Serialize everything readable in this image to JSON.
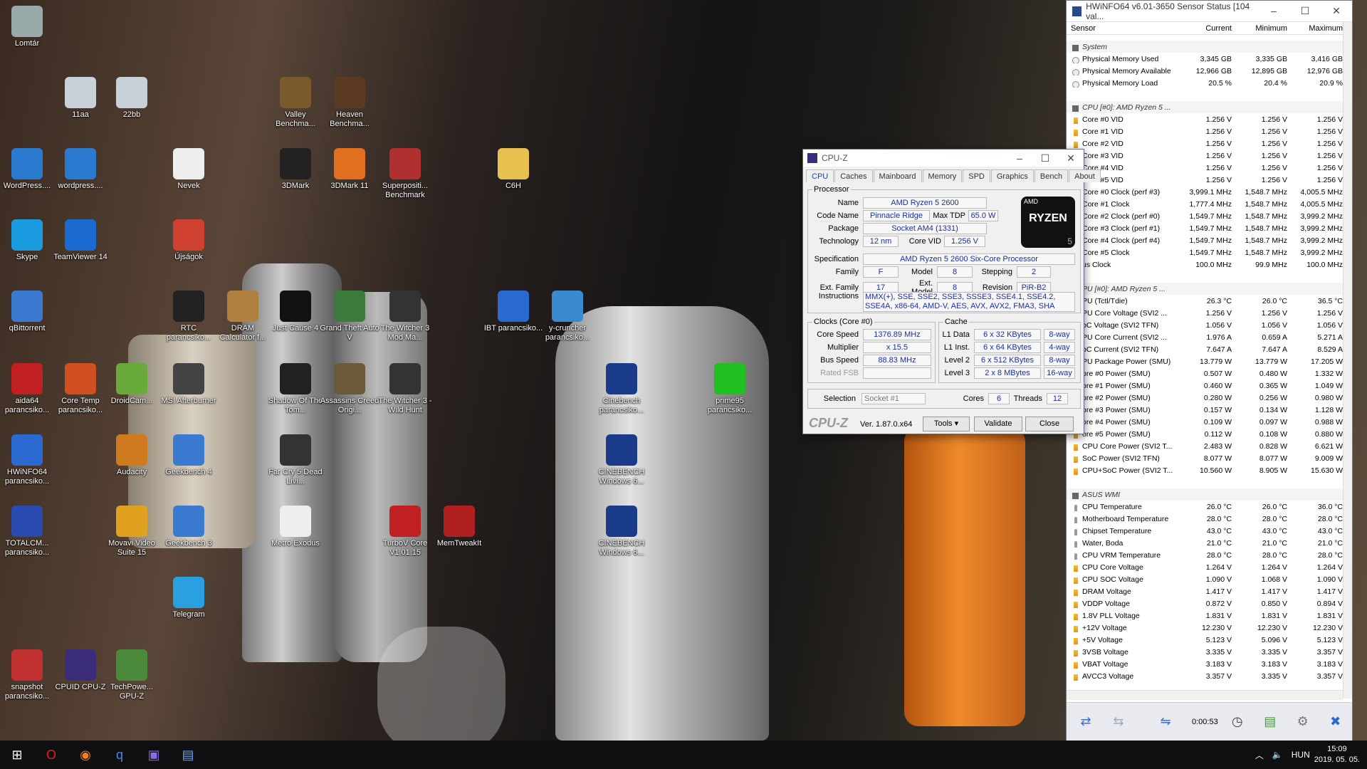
{
  "desktop": {
    "icons": [
      {
        "label": "Lomtár",
        "icon": "recycle-bin-icon",
        "color": "#9aa"
      },
      {
        "label": "11aa",
        "icon": "image-file-icon",
        "color": "#c8d0d8"
      },
      {
        "label": "22bb",
        "icon": "image-file-icon",
        "color": "#c8d0d8"
      },
      {
        "label": "Valley Benchma...",
        "icon": "valley-benchmark-icon",
        "color": "#7a5a2a"
      },
      {
        "label": "Heaven Benchma...",
        "icon": "heaven-benchmark-icon",
        "color": "#5a3a22"
      },
      {
        "label": "WordPress....",
        "icon": "wordpress-icon",
        "color": "#2a7ad0"
      },
      {
        "label": "wordpress....",
        "icon": "wordpress-icon",
        "color": "#2a7ad0"
      },
      {
        "label": "Nevek",
        "icon": "text-file-icon",
        "color": "#eee"
      },
      {
        "label": "3DMark",
        "icon": "3dmark-icon",
        "color": "#222"
      },
      {
        "label": "3DMark 11",
        "icon": "3dmark11-icon",
        "color": "#e07020"
      },
      {
        "label": "Superpositi... Benchmark",
        "icon": "superposition-icon",
        "color": "#b03030"
      },
      {
        "label": "C6H",
        "icon": "folder-icon",
        "color": "#e8c050"
      },
      {
        "label": "Skype",
        "icon": "skype-icon",
        "color": "#1a9be0"
      },
      {
        "label": "TeamViewer 14",
        "icon": "teamviewer-icon",
        "color": "#1a6ad0"
      },
      {
        "label": "Újságok",
        "icon": "pdf-icon",
        "color": "#d04030"
      },
      {
        "label": "qBittorrent",
        "icon": "qbittorrent-icon",
        "color": "#3a7ad0"
      },
      {
        "label": "RTC parancsiko...",
        "icon": "rtc-icon",
        "color": "#222"
      },
      {
        "label": "DRAM Calculator f...",
        "icon": "dram-calculator-icon",
        "color": "#b08040"
      },
      {
        "label": "Just Cause 4",
        "icon": "just-cause-icon",
        "color": "#111"
      },
      {
        "label": "Grand Theft Auto V",
        "icon": "gta-icon",
        "color": "#3a7a3a"
      },
      {
        "label": "The Witcher 3 Mod Ma...",
        "icon": "witcher-icon",
        "color": "#333"
      },
      {
        "label": "IBT parancsiko...",
        "icon": "intel-icon",
        "color": "#2a6ad0"
      },
      {
        "label": "y-cruncher parancsiko...",
        "icon": "y-cruncher-icon",
        "color": "#3a8ad0"
      },
      {
        "label": "aida64 parancsiko...",
        "icon": "aida64-icon",
        "color": "#c02020"
      },
      {
        "label": "Core Temp parancsiko...",
        "icon": "core-temp-icon",
        "color": "#d05020"
      },
      {
        "label": "DroidCam...",
        "icon": "droidcam-icon",
        "color": "#6aaa3a"
      },
      {
        "label": "MSI Afterburner",
        "icon": "afterburner-icon",
        "color": "#444"
      },
      {
        "label": "Shadow Of The Tom...",
        "icon": "tomb-raider-icon",
        "color": "#222"
      },
      {
        "label": "Assassins Creed Origi...",
        "icon": "assassins-icon",
        "color": "#6a5a3a"
      },
      {
        "label": "The Witcher 3 - Wild Hunt",
        "icon": "witcher-icon",
        "color": "#333"
      },
      {
        "label": "Cinebench parancsiko...",
        "icon": "cinebench-icon",
        "color": "#1a3a8a"
      },
      {
        "label": "prime95 parancsiko...",
        "icon": "prime95-icon",
        "color": "#20c020"
      },
      {
        "label": "HWiNFO64 parancsiko...",
        "icon": "hwinfo-icon",
        "color": "#2a6ad0"
      },
      {
        "label": "Audacity",
        "icon": "audacity-icon",
        "color": "#d07a20"
      },
      {
        "label": "Geekbench 4",
        "icon": "geekbench-icon",
        "color": "#3a7ad0"
      },
      {
        "label": "Far Cry 5 Dead Livi...",
        "icon": "far-cry-icon",
        "color": "#333"
      },
      {
        "label": "CINEBENCH Windows 6...",
        "icon": "cinebench-icon",
        "color": "#1a3a8a"
      },
      {
        "label": "TOTALCM... parancsiko...",
        "icon": "total-commander-icon",
        "color": "#2a4ab0"
      },
      {
        "label": "Movavi Video Suite 15",
        "icon": "movavi-icon",
        "color": "#e0a020"
      },
      {
        "label": "Geekbench 3",
        "icon": "geekbench-icon",
        "color": "#3a7ad0"
      },
      {
        "label": "Metro Exodus",
        "icon": "metro-icon",
        "color": "#eee"
      },
      {
        "label": "TurboV Core V1.01.15",
        "icon": "turbov-icon",
        "color": "#c02020"
      },
      {
        "label": "MemTweakIt",
        "icon": "memtweakit-icon",
        "color": "#b02020"
      },
      {
        "label": "CINEBENCH Windows 6...",
        "icon": "cinebench-icon",
        "color": "#1a3a8a"
      },
      {
        "label": "Telegram",
        "icon": "telegram-icon",
        "color": "#2aa0e0"
      },
      {
        "label": "snapshot parancsiko...",
        "icon": "snapshot-icon",
        "color": "#c03030"
      },
      {
        "label": "CPUID CPU-Z",
        "icon": "cpuz-icon",
        "color": "#3b2d7a"
      },
      {
        "label": "TechPowe... GPU-Z",
        "icon": "gpuz-icon",
        "color": "#4a8a3a"
      }
    ]
  },
  "cpuz": {
    "title": "CPU-Z",
    "tabs": [
      "CPU",
      "Caches",
      "Mainboard",
      "Memory",
      "SPD",
      "Graphics",
      "Bench",
      "About"
    ],
    "processor_legend": "Processor",
    "name_label": "Name",
    "name": "AMD Ryzen 5 2600",
    "codename_label": "Code Name",
    "codename": "Pinnacle Ridge",
    "maxtdp_label": "Max TDP",
    "maxtdp": "65.0 W",
    "package_label": "Package",
    "package": "Socket AM4 (1331)",
    "tech_label": "Technology",
    "tech": "12 nm",
    "corevid_label": "Core VID",
    "corevid": "1.256 V",
    "spec_label": "Specification",
    "spec": "AMD Ryzen 5 2600 Six-Core Processor",
    "family_label": "Family",
    "family": "F",
    "model_label": "Model",
    "model": "8",
    "stepping_label": "Stepping",
    "stepping": "2",
    "extfamily_label": "Ext. Family",
    "extfamily": "17",
    "extmodel_label": "Ext. Model",
    "extmodel": "8",
    "revision_label": "Revision",
    "revision": "PiR-B2",
    "instr_label": "Instructions",
    "instr": "MMX(+), SSE, SSE2, SSE3, SSSE3, SSE4.1, SSE4.2, SSE4A, x86-64, AMD-V, AES, AVX, AVX2, FMA3, SHA",
    "logo_brand": "AMD",
    "logo_text": "RYZEN",
    "logo_num": "5",
    "clocks_legend": "Clocks (Core #0)",
    "corespeed_label": "Core Speed",
    "corespeed": "1376.89 MHz",
    "mult_label": "Multiplier",
    "mult": "x 15.5",
    "busspeed_label": "Bus Speed",
    "busspeed": "88.83 MHz",
    "ratedfsb_label": "Rated FSB",
    "ratedfsb": "",
    "cache_legend": "Cache",
    "l1d_label": "L1 Data",
    "l1d": "6 x 32 KBytes",
    "l1d_way": "8-way",
    "l1i_label": "L1 Inst.",
    "l1i": "6 x 64 KBytes",
    "l1i_way": "4-way",
    "l2_label": "Level 2",
    "l2": "6 x 512 KBytes",
    "l2_way": "8-way",
    "l3_label": "Level 3",
    "l3": "2 x 8 MBytes",
    "l3_way": "16-way",
    "selection_label": "Selection",
    "selection": "Socket #1",
    "cores_label": "Cores",
    "cores": "6",
    "threads_label": "Threads",
    "threads": "12",
    "brand": "CPU-Z",
    "version": "Ver. 1.87.0.x64",
    "tools": "Tools",
    "validate": "Validate",
    "close": "Close"
  },
  "hwinfo": {
    "title": "HWiNFO64 v6.01-3650 Sensor Status [104 val...",
    "cols": [
      "Sensor",
      "Current",
      "Minimum",
      "Maximum"
    ],
    "rows": [
      {
        "n": "System",
        "g": true,
        "i": "g"
      },
      {
        "n": "Physical Memory Used",
        "c": "3,345 GB",
        "mi": "3,335 GB",
        "ma": "3,416 GB",
        "i": "o"
      },
      {
        "n": "Physical Memory Available",
        "c": "12,966 GB",
        "mi": "12,895 GB",
        "ma": "12,976 GB",
        "i": "o"
      },
      {
        "n": "Physical Memory Load",
        "c": "20.5 %",
        "mi": "20.4 %",
        "ma": "20.9 %",
        "i": "o"
      },
      {
        "n": "",
        "c": "",
        "mi": "",
        "ma": "",
        "i": ""
      },
      {
        "n": "CPU [#0]: AMD Ryzen 5 ...",
        "g": true,
        "i": "g"
      },
      {
        "n": "Core #0 VID",
        "c": "1.256 V",
        "mi": "1.256 V",
        "ma": "1.256 V",
        "i": "v"
      },
      {
        "n": "Core #1 VID",
        "c": "1.256 V",
        "mi": "1.256 V",
        "ma": "1.256 V",
        "i": "v"
      },
      {
        "n": "Core #2 VID",
        "c": "1.256 V",
        "mi": "1.256 V",
        "ma": "1.256 V",
        "i": "v"
      },
      {
        "n": "Core #3 VID",
        "c": "1.256 V",
        "mi": "1.256 V",
        "ma": "1.256 V",
        "i": "v"
      },
      {
        "n": "Core #4 VID",
        "c": "1.256 V",
        "mi": "1.256 V",
        "ma": "1.256 V",
        "i": "v"
      },
      {
        "n": "Core #5 VID",
        "c": "1.256 V",
        "mi": "1.256 V",
        "ma": "1.256 V",
        "i": "v"
      },
      {
        "n": "Core #0 Clock (perf #3)",
        "c": "3,999.1 MHz",
        "mi": "1,548.7 MHz",
        "ma": "4,005.5 MHz",
        "i": "o"
      },
      {
        "n": "Core #1 Clock",
        "c": "1,777.4 MHz",
        "mi": "1,548.7 MHz",
        "ma": "4,005.5 MHz",
        "i": "o"
      },
      {
        "n": "Core #2 Clock (perf #0)",
        "c": "1,549.7 MHz",
        "mi": "1,548.7 MHz",
        "ma": "3,999.2 MHz",
        "i": "o"
      },
      {
        "n": "Core #3 Clock (perf #1)",
        "c": "1,549.7 MHz",
        "mi": "1,548.7 MHz",
        "ma": "3,999.2 MHz",
        "i": "o"
      },
      {
        "n": "Core #4 Clock (perf #4)",
        "c": "1,549.7 MHz",
        "mi": "1,548.7 MHz",
        "ma": "3,999.2 MHz",
        "i": "o"
      },
      {
        "n": "Core #5 Clock",
        "c": "1,549.7 MHz",
        "mi": "1,548.7 MHz",
        "ma": "3,999.2 MHz",
        "i": "o"
      },
      {
        "n": "us Clock",
        "c": "100.0 MHz",
        "mi": "99.9 MHz",
        "ma": "100.0 MHz",
        "i": "o"
      },
      {
        "n": "",
        "c": "",
        "mi": "",
        "ma": "",
        "i": ""
      },
      {
        "n": "PU [#0]: AMD Ryzen 5 ...",
        "g": true,
        "i": "g"
      },
      {
        "n": "PU (Tctl/Tdie)",
        "c": "26.3 °C",
        "mi": "26.0 °C",
        "ma": "36.5 °C",
        "i": "t"
      },
      {
        "n": "PU Core Voltage (SVI2 ...",
        "c": "1.256 V",
        "mi": "1.256 V",
        "ma": "1.256 V",
        "i": "v"
      },
      {
        "n": "oC Voltage (SVI2 TFN)",
        "c": "1.056 V",
        "mi": "1.056 V",
        "ma": "1.056 V",
        "i": "v"
      },
      {
        "n": "PU Core Current (SVI2 ...",
        "c": "1.976 A",
        "mi": "0.659 A",
        "ma": "5.271 A",
        "i": "v"
      },
      {
        "n": "oC Current (SVI2 TFN)",
        "c": "7.647 A",
        "mi": "7.647 A",
        "ma": "8.529 A",
        "i": "v"
      },
      {
        "n": "PU Package Power (SMU)",
        "c": "13.779 W",
        "mi": "13.779 W",
        "ma": "17.205 W",
        "i": "v"
      },
      {
        "n": "ore #0 Power (SMU)",
        "c": "0.507 W",
        "mi": "0.480 W",
        "ma": "1.332 W",
        "i": "v"
      },
      {
        "n": "ore #1 Power (SMU)",
        "c": "0.460 W",
        "mi": "0.365 W",
        "ma": "1.049 W",
        "i": "v"
      },
      {
        "n": "ore #2 Power (SMU)",
        "c": "0.280 W",
        "mi": "0.256 W",
        "ma": "0.980 W",
        "i": "v"
      },
      {
        "n": "ore #3 Power (SMU)",
        "c": "0.157 W",
        "mi": "0.134 W",
        "ma": "1.128 W",
        "i": "v"
      },
      {
        "n": "ore #4 Power (SMU)",
        "c": "0.109 W",
        "mi": "0.097 W",
        "ma": "0.988 W",
        "i": "v"
      },
      {
        "n": "ore #5 Power (SMU)",
        "c": "0.112 W",
        "mi": "0.108 W",
        "ma": "0.880 W",
        "i": "v"
      },
      {
        "n": "CPU Core Power (SVI2 T...",
        "c": "2.483 W",
        "mi": "0.828 W",
        "ma": "6.621 W",
        "i": "v"
      },
      {
        "n": "SoC Power (SVI2 TFN)",
        "c": "8.077 W",
        "mi": "8.077 W",
        "ma": "9.009 W",
        "i": "v"
      },
      {
        "n": "CPU+SoC Power (SVI2 T...",
        "c": "10.560 W",
        "mi": "8.905 W",
        "ma": "15.630 W",
        "i": "v"
      },
      {
        "n": "",
        "c": "",
        "mi": "",
        "ma": "",
        "i": ""
      },
      {
        "n": "ASUS WMI",
        "g": true,
        "i": "g"
      },
      {
        "n": "CPU Temperature",
        "c": "26.0 °C",
        "mi": "26.0 °C",
        "ma": "36.0 °C",
        "i": "t"
      },
      {
        "n": "Motherboard Temperature",
        "c": "28.0 °C",
        "mi": "28.0 °C",
        "ma": "28.0 °C",
        "i": "t"
      },
      {
        "n": "Chipset Temperature",
        "c": "43.0 °C",
        "mi": "43.0 °C",
        "ma": "43.0 °C",
        "i": "t"
      },
      {
        "n": "Water, Boda",
        "c": "21.0 °C",
        "mi": "21.0 °C",
        "ma": "21.0 °C",
        "i": "t"
      },
      {
        "n": "CPU VRM Temperature",
        "c": "28.0 °C",
        "mi": "28.0 °C",
        "ma": "28.0 °C",
        "i": "t"
      },
      {
        "n": "CPU Core Voltage",
        "c": "1.264 V",
        "mi": "1.264 V",
        "ma": "1.264 V",
        "i": "v"
      },
      {
        "n": "CPU SOC Voltage",
        "c": "1.090 V",
        "mi": "1.068 V",
        "ma": "1.090 V",
        "i": "v"
      },
      {
        "n": "DRAM Voltage",
        "c": "1.417 V",
        "mi": "1.417 V",
        "ma": "1.417 V",
        "i": "v"
      },
      {
        "n": "VDDP Voltage",
        "c": "0.872 V",
        "mi": "0.850 V",
        "ma": "0.894 V",
        "i": "v"
      },
      {
        "n": "1.8V PLL Voltage",
        "c": "1.831 V",
        "mi": "1.831 V",
        "ma": "1.831 V",
        "i": "v"
      },
      {
        "n": "+12V Voltage",
        "c": "12.230 V",
        "mi": "12.230 V",
        "ma": "12.230 V",
        "i": "v"
      },
      {
        "n": "+5V Voltage",
        "c": "5.123 V",
        "mi": "5.096 V",
        "ma": "5.123 V",
        "i": "v"
      },
      {
        "n": "3VSB Voltage",
        "c": "3.335 V",
        "mi": "3.335 V",
        "ma": "3.357 V",
        "i": "v"
      },
      {
        "n": "VBAT Voltage",
        "c": "3.183 V",
        "mi": "3.183 V",
        "ma": "3.183 V",
        "i": "v"
      },
      {
        "n": "AVCC3 Voltage",
        "c": "3.357 V",
        "mi": "3.335 V",
        "ma": "3.357 V",
        "i": "v"
      }
    ],
    "timer": "0:00:53"
  },
  "taskbar": {
    "items": [
      {
        "icon": "windows-start-icon",
        "glyph": "⊞"
      },
      {
        "icon": "opera-icon",
        "glyph": "O"
      },
      {
        "icon": "firefox-icon",
        "glyph": "◉"
      },
      {
        "icon": "qbittorrent-icon",
        "glyph": "q"
      },
      {
        "icon": "cpuz-icon",
        "glyph": "▣"
      },
      {
        "icon": "hwinfo-icon",
        "glyph": "▤"
      }
    ],
    "lang": "HUN",
    "time": "15:09",
    "date": "2019. 05. 05."
  }
}
